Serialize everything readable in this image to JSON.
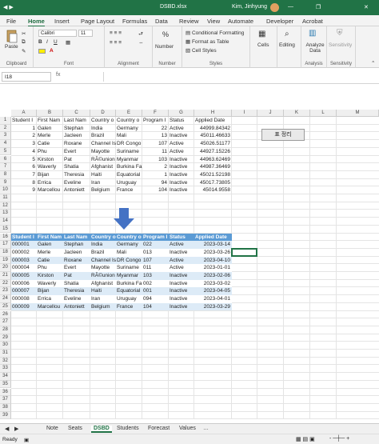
{
  "titlebar": {
    "filename": "DSBD.xlsx",
    "user": "Kim, Jinhyung"
  },
  "tabs": [
    "File",
    "Home",
    "Insert",
    "Page Layout",
    "Formulas",
    "Data",
    "Review",
    "View",
    "Automate",
    "Developer",
    "Acrobat"
  ],
  "ribbon": {
    "clipboard": {
      "label": "Clipboard",
      "paste": "Paste"
    },
    "font": {
      "label": "Font",
      "family": "Calibri",
      "size": "11",
      "bold": "B",
      "italic": "I",
      "underline": "U"
    },
    "alignment": {
      "label": "Alignment"
    },
    "number": {
      "label": "Number",
      "pct": "%"
    },
    "styles": {
      "label": "Styles",
      "cond": "Conditional Formatting",
      "table": "Format as Table",
      "cell": "Cell Styles"
    },
    "cells": {
      "label": "Cells"
    },
    "editing": {
      "label": "Editing"
    },
    "analysis": {
      "label": "Analysis",
      "btn": "Analyze Data"
    },
    "sensitivity": {
      "label": "Sensitivity",
      "btn": "Sensitivity"
    }
  },
  "formula_bar": {
    "name_box": "I18",
    "fx": "fx",
    "value": ""
  },
  "columns": [
    "A",
    "B",
    "C",
    "D",
    "E",
    "F",
    "G",
    "H",
    "I",
    "J",
    "K",
    "L",
    "M"
  ],
  "top_table": {
    "headers": [
      "Student I",
      "First Nam",
      "Last Nam",
      "Country o",
      "Country o",
      "Program I",
      "Status",
      "Applied Date"
    ],
    "rows": [
      [
        "1",
        "Galen",
        "Stephan",
        "India",
        "Germany",
        "22",
        "Active",
        "44999.84342"
      ],
      [
        "2",
        "Merle",
        "Jacleen",
        "Brazil",
        "Mali",
        "13",
        "Inactive",
        "45011.46633"
      ],
      [
        "3",
        "Catie",
        "Roxane",
        "Channel Is",
        "DR Congo",
        "107",
        "Active",
        "45026.51177"
      ],
      [
        "4",
        "Phu",
        "Evert",
        "Mayotte",
        "Suriname",
        "11",
        "Active",
        "44927.15226"
      ],
      [
        "5",
        "Kirston",
        "Pat",
        "RÃ©union",
        "Myanmar",
        "103",
        "Inactive",
        "44963.62469"
      ],
      [
        "6",
        "Waverly",
        "Shatia",
        "Afghanist",
        "Burkina Fa",
        "2",
        "Inactive",
        "44987.36469"
      ],
      [
        "7",
        "Bijan",
        "Theresia",
        "Haiti",
        "Equatorial",
        "1",
        "Inactive",
        "45021.52198"
      ],
      [
        "8",
        "Errica",
        "Eveline",
        "Iran",
        "Uruguay",
        "94",
        "Inactive",
        "45017.73805"
      ],
      [
        "9",
        "Marcellou",
        "Antoniett",
        "Belgium",
        "France",
        "104",
        "Inactive",
        "45014.9558"
      ]
    ]
  },
  "bottom_table": {
    "headers": [
      "Student I",
      "First Nam",
      "Last Nam",
      "Country o",
      "Country o",
      "Program I",
      "Status",
      "Applied Date"
    ],
    "rows": [
      [
        "000001",
        "Galen",
        "Stephan",
        "India",
        "Germany",
        "022",
        "Active",
        "2023-03-14"
      ],
      [
        "000002",
        "Merle",
        "Jacleen",
        "Brazil",
        "Mali",
        "013",
        "Inactive",
        "2023-03-26"
      ],
      [
        "000003",
        "Catie",
        "Roxane",
        "Channel Is",
        "DR Congo",
        "107",
        "Active",
        "2023-04-10"
      ],
      [
        "000004",
        "Phu",
        "Evert",
        "Mayotte",
        "Suriname",
        "011",
        "Active",
        "2023-01-01"
      ],
      [
        "000005",
        "Kirston",
        "Pat",
        "RÃ©union",
        "Myanmar",
        "103",
        "Inactive",
        "2023-02-06"
      ],
      [
        "000006",
        "Waverly",
        "Shatia",
        "Afghanist",
        "Burkina Fa",
        "002",
        "Inactive",
        "2023-03-02"
      ],
      [
        "000007",
        "Bijan",
        "Theresia",
        "Haiti",
        "Equatorial",
        "001",
        "Inactive",
        "2023-04-05"
      ],
      [
        "000008",
        "Errica",
        "Eveline",
        "Iran",
        "Uruguay",
        "094",
        "Inactive",
        "2023-04-01"
      ],
      [
        "000009",
        "Marcellou",
        "Antoniett",
        "Belgium",
        "France",
        "104",
        "Inactive",
        "2023-03-29"
      ]
    ]
  },
  "button_label": "표 정리",
  "sheet_tabs": [
    "Note",
    "Seats",
    "DSBD",
    "Students",
    "Forecast",
    "Values"
  ],
  "status": {
    "ready": "Ready"
  },
  "colors": {
    "excel_green": "#217346",
    "header_blue": "#5b9bd5",
    "band_blue": "#ddebf7",
    "arrow": "#4472c4"
  }
}
